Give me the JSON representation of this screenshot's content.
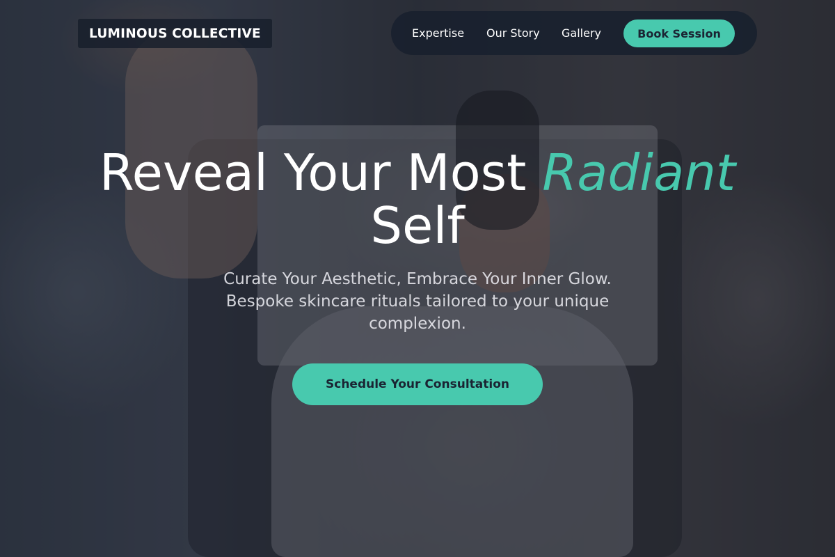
{
  "brand": {
    "name": "LUMINOUS COLLECTIVE"
  },
  "nav": {
    "links": [
      {
        "label": "Expertise"
      },
      {
        "label": "Our Story"
      },
      {
        "label": "Gallery"
      }
    ],
    "book_label": "Book Session"
  },
  "hero": {
    "headline_part1": "Reveal Your Most ",
    "headline_accent": "Radiant",
    "headline_part2": " Self",
    "subtext": "Curate Your Aesthetic, Embrace Your Inner Glow. Bespoke skincare rituals tailored to your unique complexion.",
    "cta_label": "Schedule Your Consultation"
  },
  "colors": {
    "accent": "#48c9ae",
    "dark": "#1a2433",
    "text_light": "#ffffff"
  }
}
